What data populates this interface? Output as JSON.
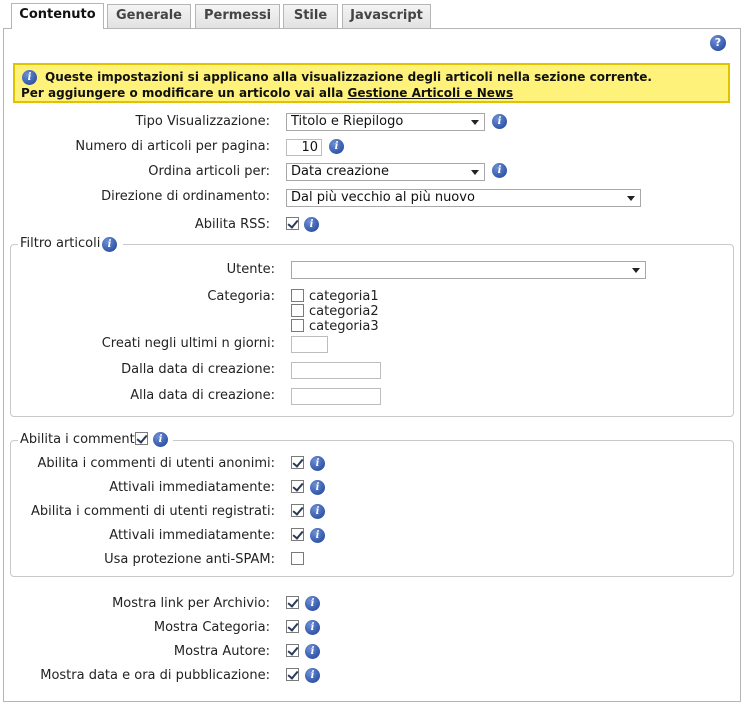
{
  "tabs": [
    "Contenuto",
    "Generale",
    "Permessi",
    "Stile",
    "Javascript"
  ],
  "help_icon": "question-icon",
  "notice": {
    "line1": "Queste impostazioni si applicano alla visualizzazione degli articoli nella sezione corrente.",
    "line2_prefix": "Per aggiungere o modificare un articolo vai alla ",
    "link": "Gestione Articoli e News"
  },
  "display": {
    "tipo_label": "Tipo Visualizzazione:",
    "tipo_value": "Titolo e Riepilogo",
    "numero_label": "Numero di articoli per pagina:",
    "numero_value": "10",
    "ordina_label": "Ordina articoli per:",
    "ordina_value": "Data creazione",
    "direzione_label": "Direzione di ordinamento:",
    "direzione_value": "Dal più vecchio al più nuovo",
    "rss_label": "Abilita RSS:"
  },
  "filtro": {
    "legend": "Filtro articoli",
    "utente_label": "Utente:",
    "utente_value": "",
    "categoria_label": "Categoria:",
    "categorie": [
      "categoria1",
      "categoria2",
      "categoria3"
    ],
    "ultimi_label": "Creati negli ultimi n giorni:",
    "dalla_label": "Dalla data di creazione:",
    "alla_label": "Alla data di creazione:"
  },
  "commenti": {
    "legend": "Abilita i commenti",
    "anonimi_label": "Abilita i commenti di utenti anonimi:",
    "attivali1_label": "Attivali immediatamente:",
    "registrati_label": "Abilita i commenti di utenti registrati:",
    "attivali2_label": "Attivali immediatamente:",
    "antispam_label": "Usa protezione anti-SPAM:"
  },
  "mostra": {
    "archivio_label": "Mostra link per Archivio:",
    "categoria_label": "Mostra Categoria:",
    "autore_label": "Mostra Autore:",
    "data_label": "Mostra data e ora di pubblicazione:"
  },
  "checkboxes": {
    "rss": true,
    "categoria1": false,
    "categoria2": false,
    "categoria3": false,
    "commenti": true,
    "anonimi": true,
    "attivali1": true,
    "registrati": true,
    "attivali2": true,
    "antispam": false,
    "archivio": true,
    "mostra_categoria": true,
    "autore": true,
    "data": true
  },
  "colors": {
    "notice_bg": "#fff27a",
    "notice_border": "#e0c200",
    "info_icon": "#1a3f95"
  },
  "info_icon_glyph": "i",
  "help_icon_glyph": "?"
}
